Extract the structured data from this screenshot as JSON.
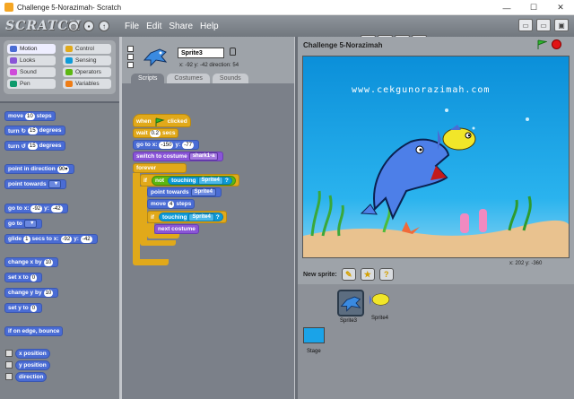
{
  "window": {
    "title": "Challenge 5-Norazimah- Scratch",
    "min": "—",
    "max": "☐",
    "close": "✕"
  },
  "menubar": {
    "logo": "SCRATCH",
    "menus": [
      "File",
      "Edit",
      "Share",
      "Help"
    ]
  },
  "categories": [
    {
      "label": "Motion",
      "color": "#4a6cd4"
    },
    {
      "label": "Control",
      "color": "#e1a91a"
    },
    {
      "label": "Looks",
      "color": "#8a55d7"
    },
    {
      "label": "Sensing",
      "color": "#0e9bd8"
    },
    {
      "label": "Sound",
      "color": "#cf4ad9"
    },
    {
      "label": "Operators",
      "color": "#5cb712"
    },
    {
      "label": "Pen",
      "color": "#0e9a6c"
    },
    {
      "label": "Variables",
      "color": "#ee7d16"
    }
  ],
  "palette": {
    "move": {
      "pre": "move",
      "val": "10",
      "post": "steps"
    },
    "turn_cw": {
      "pre": "turn ↻",
      "val": "15",
      "post": "degrees"
    },
    "turn_ccw": {
      "pre": "turn ↺",
      "val": "15",
      "post": "degrees"
    },
    "point_dir": {
      "pre": "point in direction",
      "val": "90▾"
    },
    "point_towards": {
      "pre": "point towards"
    },
    "goto_xy": {
      "pre": "go to x:",
      "x": "-92",
      "mid": "y:",
      "y": "-42"
    },
    "goto": {
      "pre": "go to"
    },
    "glide": {
      "pre": "glide",
      "val": "1",
      "mid": "secs to x:",
      "x": "-92",
      "mid2": "y:",
      "y": "-42"
    },
    "change_x": {
      "pre": "change x by",
      "val": "10"
    },
    "set_x": {
      "pre": "set x to",
      "val": "0"
    },
    "change_y": {
      "pre": "change y by",
      "val": "10"
    },
    "set_y": {
      "pre": "set y to",
      "val": "0"
    },
    "bounce": "if on edge, bounce",
    "xpos": "x position",
    "ypos": "y position",
    "direction": "direction"
  },
  "sprite": {
    "name": "Sprite3",
    "coords": "x: -92   y: -42   direction: 54"
  },
  "tabs": [
    "Scripts",
    "Costumes",
    "Sounds"
  ],
  "script": {
    "when_clicked_pre": "when",
    "when_clicked_post": "clicked",
    "wait": {
      "pre": "wait",
      "val": "0.2",
      "post": "secs"
    },
    "goto": {
      "pre": "go to x:",
      "x": "-150",
      "mid": "y:",
      "y": "-77"
    },
    "costume": {
      "pre": "switch to costume",
      "val": "shark1-a"
    },
    "forever": "forever",
    "if1": "if",
    "not": "not",
    "touching1": {
      "pre": "touching",
      "val": "Sprite4",
      "q": "?"
    },
    "point_towards": {
      "pre": "point towards",
      "val": "Sprite4"
    },
    "move": {
      "pre": "move",
      "val": "4",
      "post": "steps"
    },
    "if2": "if",
    "touching2": {
      "pre": "touching",
      "val": "Sprite4",
      "q": "?"
    },
    "next_costume": "next costume"
  },
  "stage": {
    "title": "Challenge 5-Norazimah",
    "watermark": "www.cekgunorazimah.com",
    "mouse": "x: 202   y: -360"
  },
  "new_sprite": {
    "label": "New sprite:"
  },
  "sprites": [
    {
      "name": "Sprite3",
      "selected": true
    },
    {
      "name": "Sprite4",
      "selected": false
    }
  ],
  "stage_thumb_label": "Stage"
}
